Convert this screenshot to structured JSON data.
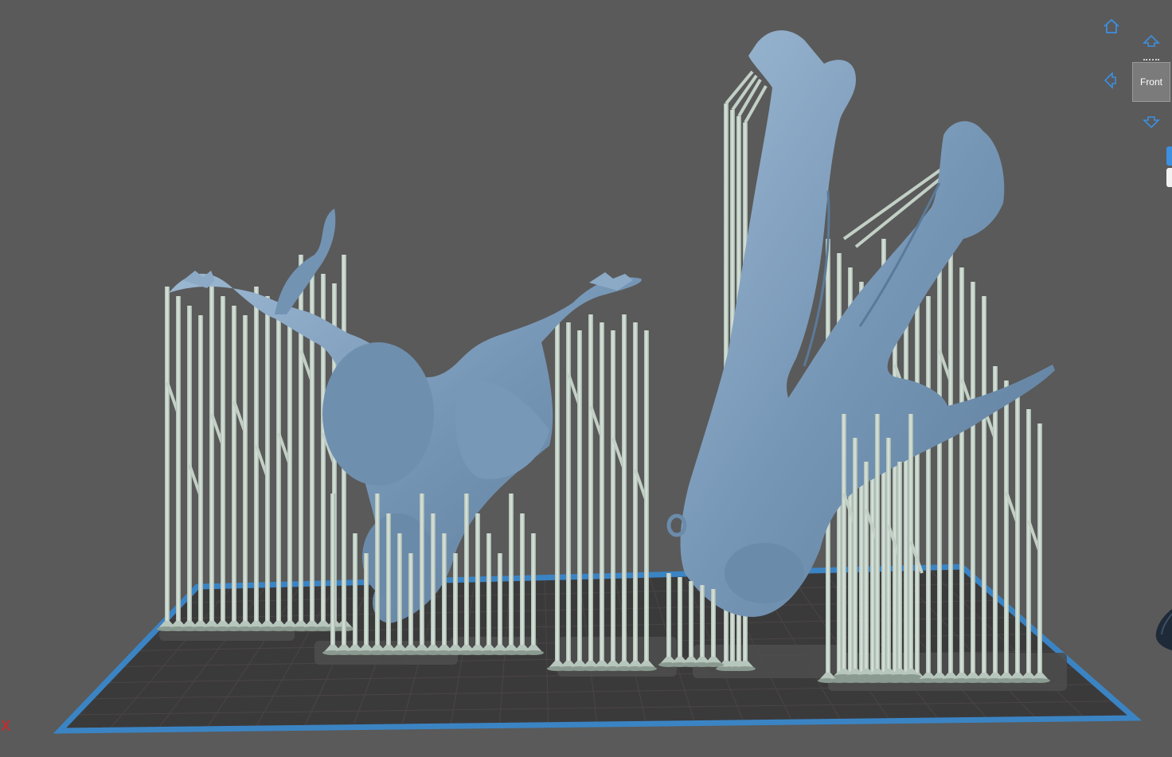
{
  "viewport": {
    "background": "#5a5a5a",
    "plate_color": "#3b3a3b",
    "plate_border_color": "#3b84c4",
    "grid_color": "#4a4545",
    "support_color": "#c9d6cd",
    "model_color": "#7f9fbd"
  },
  "nav": {
    "home_icon": "home-icon",
    "up_icon": "arrow-up-icon",
    "left_icon": "arrow-left-icon",
    "down_icon": "arrow-down-icon",
    "view_cube_label": "Front"
  },
  "axis": {
    "x_label": "X",
    "x_color": "#e02020"
  },
  "side_tabs": {
    "active_color": "#3d8fe0",
    "inactive_color": "#f2f2f2"
  }
}
